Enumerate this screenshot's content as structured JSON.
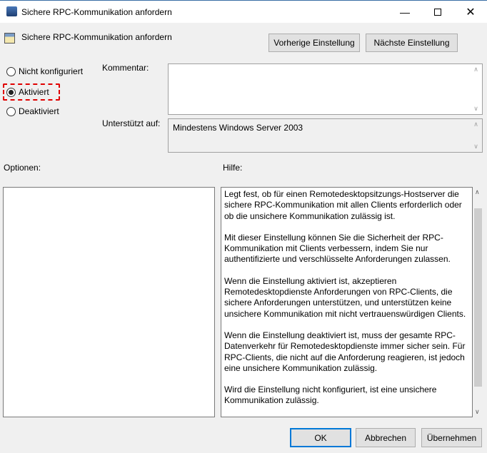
{
  "window": {
    "title": "Sichere RPC-Kommunikation anfordern",
    "minimize_icon": "minimize-icon",
    "maximize_icon": "maximize-icon",
    "close_icon": "close-icon"
  },
  "header": {
    "title": "Sichere RPC-Kommunikation anfordern",
    "prev_label": "Vorherige Einstellung",
    "next_label": "Nächste Einstellung"
  },
  "state": {
    "options": [
      "Nicht konfiguriert",
      "Aktiviert",
      "Deaktiviert"
    ],
    "selected": "Aktiviert",
    "highlight_color": "#e00000"
  },
  "comment": {
    "label": "Kommentar:",
    "value": ""
  },
  "supported": {
    "label": "Unterstützt auf:",
    "value": "Mindestens Windows Server 2003"
  },
  "options_label": "Optionen:",
  "help": {
    "label": "Hilfe:",
    "paragraphs": [
      "Legt fest, ob für einen Remotedesktopsitzungs-Hostserver die sichere RPC-Kommunikation mit allen Clients erforderlich oder ob die unsichere Kommunikation zulässig ist.",
      "Mit dieser Einstellung können Sie die Sicherheit der RPC-Kommunikation mit Clients verbessern, indem Sie nur authentifizierte und verschlüsselte Anforderungen zulassen.",
      "Wenn die Einstellung aktiviert ist, akzeptieren Remotedesktopdienste Anforderungen von RPC-Clients, die sichere Anforderungen unterstützen, und unterstützen keine unsichere Kommunikation mit nicht vertrauenswürdigen Clients.",
      "Wenn die Einstellung deaktiviert ist, muss der gesamte RPC-Datenverkehr für Remotedesktopdienste immer sicher sein. Für RPC-Clients, die nicht auf die Anforderung reagieren, ist jedoch eine unsichere Kommunikation zulässig.",
      "Wird die Einstellung nicht konfiguriert, ist eine unsichere Kommunikation zulässig."
    ]
  },
  "footer": {
    "ok": "OK",
    "cancel": "Abbrechen",
    "apply": "Übernehmen"
  }
}
